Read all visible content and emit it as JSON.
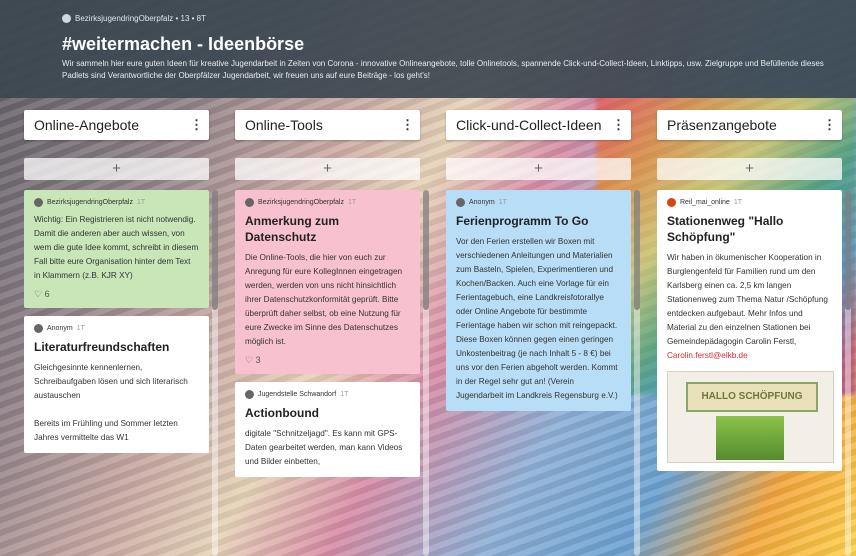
{
  "header": {
    "meta": "BezirksjugendringOberpfalz • 13 • 8T",
    "title": "#weitermachen - Ideenbörse",
    "description": "Wir sammeln hier eure guten Ideen für kreative Jugendarbeit in Zeiten von Corona - innovative Onlineangebote, tolle Onlinetools, spannende Click-und-Collect-Ideen, Linktipps, usw. Zielgruppe und Befüllende dieses Padlets sind Verantwortliche der Oberpfälzer Jugendarbeit, wir freuen uns auf eure Beiträge - los geht's!"
  },
  "add_label": "+",
  "menu_glyph": "⋮",
  "columns": [
    {
      "title": "Online-Angebote",
      "cards": [
        {
          "author": "BezirksjugendringOberpfalz",
          "time": "1T",
          "title": "",
          "body": "Wichtig: Ein Registrieren ist nicht notwendig. Damit die anderen aber auch wissen, von wem die gute Idee kommt, schreibt in diesem Fall bitte eure Organisation hinter dem Text in Klammern (z.B. KJR XY)",
          "likes": "♡ 6"
        },
        {
          "author": "Anonym",
          "time": "1T",
          "title": "Literaturfreundschaften",
          "body": "Gleichgesinnte kennenlernen, Schreibaufgaben lösen und sich literarisch austauschen\n\nBereits im Frühling und Sommer letzten Jahres vermittelte das W1",
          "likes": ""
        }
      ]
    },
    {
      "title": "Online-Tools",
      "cards": [
        {
          "author": "BezirksjugendringOberpfalz",
          "time": "1T",
          "title": "Anmerkung zum Datenschutz",
          "body": "Die Online-Tools, die hier von euch zur Anregung für eure KollegInnen eingetragen werden, werden von uns nicht hinsichtlich ihrer Datenschutzkonformität geprüft. Bitte überprüft daher selbst, ob eine Nutzung für eure Zwecke im Sinne des Datenschutzes möglich ist.",
          "likes": "♡ 3"
        },
        {
          "author": "Jugendstelle Schwandorf",
          "time": "1T",
          "title": "Actionbound",
          "body": "digitale \"Schnitzeljagd\". Es kann mit GPS-Daten gearbeitet werden, man kann Videos und Bilder einbetten,",
          "likes": ""
        }
      ]
    },
    {
      "title": "Click-und-Collect-Ideen",
      "cards": [
        {
          "author": "Anonym",
          "time": "1T",
          "title": "Ferienprogramm To Go",
          "body": "Vor den Ferien erstellen wir Boxen mit verschiedenen Anleitungen und Materialien zum Basteln, Spielen, Experimentieren und Kochen/Backen. Auch eine Vorlage für ein Ferientagebuch, eine Landkreisfotorallye oder Online Angebote für bestimmte Ferientage haben wir schon mit reingepackt. Diese Boxen können gegen einen geringen Unkostenbeitrag (je nach Inhalt 5 - 8 €) bei uns vor den Ferien abgeholt werden. Kommt in der Regel sehr gut an! (Verein Jugendarbeit im Landkreis Regensburg e.V.)",
          "likes": ""
        }
      ]
    },
    {
      "title": "Präsenzangebote",
      "cards": [
        {
          "author": "Reil_mai_online",
          "time": "1T",
          "title": "Stationenweg \"Hallo Schöpfung\"",
          "body": "Wir haben in ökumenischer Kooperation in Burglengenfeld für Familien rund um den Karlsberg einen ca. 2,5 km langen Stationenweg zum Thema Natur /Schöpfung entdecken aufgebaut. Mehr Infos und Material zu den einzelnen Stationen bei Gemeindepädagogin Carolin Ferstl,",
          "link": "Carolin.ferstl@elkb.de",
          "image_caption": "HALLO SCHÖPFUNG",
          "likes": ""
        }
      ]
    }
  ]
}
